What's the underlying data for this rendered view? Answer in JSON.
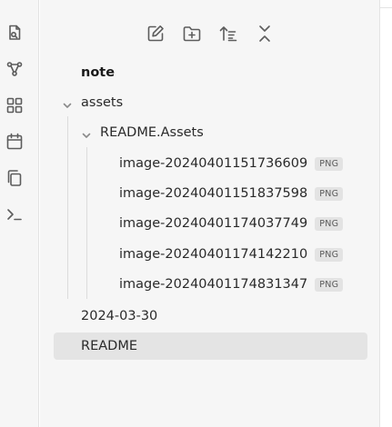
{
  "ribbon": {
    "icons": [
      "files-icon",
      "graph-icon",
      "layout-grid-icon",
      "calendar-icon",
      "copy-icon",
      "terminal-icon"
    ]
  },
  "toolbar": {
    "icons": [
      "new-note-icon",
      "new-folder-icon",
      "sort-icon",
      "collapse-all-icon"
    ]
  },
  "tree": {
    "note_label": "note",
    "assets_label": "assets",
    "readme_assets_label": "README.Assets",
    "images": [
      {
        "name": "image-20240401151736609",
        "ext": "PNG"
      },
      {
        "name": "image-20240401151837598",
        "ext": "PNG"
      },
      {
        "name": "image-20240401174037749",
        "ext": "PNG"
      },
      {
        "name": "image-20240401174142210",
        "ext": "PNG"
      },
      {
        "name": "image-20240401174831347",
        "ext": "PNG"
      }
    ],
    "date_folder_label": "2024-03-30",
    "readme_label": "README"
  }
}
